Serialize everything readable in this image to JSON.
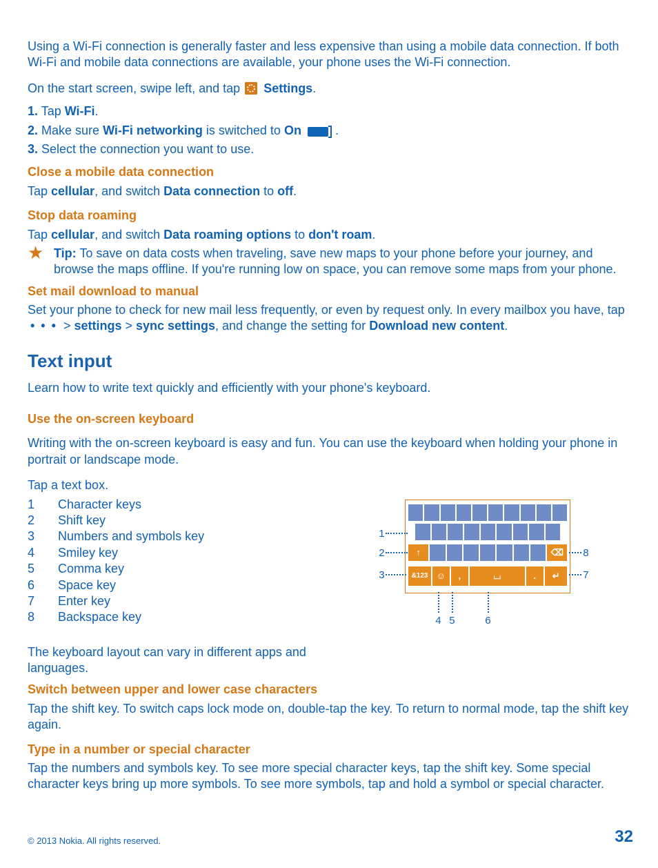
{
  "intro": {
    "p1": "Using a Wi-Fi connection is generally faster and less expensive than using a mobile data connection. If both Wi-Fi and mobile data connections are available, your phone uses the Wi-Fi connection.",
    "p2_before": "On the start screen, swipe left, and tap ",
    "p2_settings": "Settings",
    "p2_after": "."
  },
  "steps": {
    "s1": {
      "n": "1.",
      "before": " Tap ",
      "bold": "Wi-Fi",
      "after": "."
    },
    "s2": {
      "n": "2.",
      "before": " Make sure ",
      "bold1": "Wi-Fi networking",
      "mid": " is switched to ",
      "bold2": "On ",
      "after": "."
    },
    "s3": {
      "n": "3.",
      "text": " Select the connection you want to use."
    }
  },
  "close_data": {
    "heading": "Close a mobile data connection",
    "before": "Tap ",
    "b1": "cellular",
    "mid1": ", and switch ",
    "b2": "Data connection",
    "mid2": " to ",
    "b3": "off",
    "after": "."
  },
  "stop_roaming": {
    "heading": "Stop data roaming",
    "before": "Tap ",
    "b1": "cellular",
    "mid1": ", and switch ",
    "b2": "Data roaming options",
    "mid2": " to ",
    "b3": "don't roam",
    "after": "."
  },
  "tip": {
    "label": "Tip:",
    "text": " To save on data costs when traveling, save new maps to your phone before your journey, and browse the maps offline. If you're running low on space, you can remove some maps from your phone."
  },
  "mail_manual": {
    "heading": "Set mail download to manual",
    "line1": "Set your phone to check for new mail less frequently, or even by request only. In every mailbox you have, tap ",
    "ellipsis": "• • •",
    "gt1": "  > ",
    "b1": "settings",
    "gt2": " > ",
    "b2": "sync settings",
    "mid": ", and change the setting for ",
    "b3": "Download new content",
    "after": "."
  },
  "text_input": {
    "title": "Text input",
    "intro": "Learn how to write text quickly and efficiently with your phone's keyboard.",
    "use_heading": "Use the on-screen keyboard",
    "use_p": "Writing with the on-screen keyboard is easy and fun. You can use the keyboard when holding your phone in portrait or landscape mode.",
    "tap_box": "Tap a text box.",
    "legend": [
      {
        "n": "1",
        "label": "Character keys"
      },
      {
        "n": "2",
        "label": "Shift key"
      },
      {
        "n": "3",
        "label": "Numbers and symbols key"
      },
      {
        "n": "4",
        "label": "Smiley key"
      },
      {
        "n": "5",
        "label": "Comma key"
      },
      {
        "n": "6",
        "label": "Space key"
      },
      {
        "n": "7",
        "label": "Enter key"
      },
      {
        "n": "8",
        "label": "Backspace key"
      }
    ],
    "note": "The keyboard layout can vary in different apps and languages."
  },
  "switch_case": {
    "heading": "Switch between upper and lower case characters",
    "text": "Tap the shift key. To switch caps lock mode on, double-tap the key. To return to normal mode, tap the shift key again."
  },
  "type_special": {
    "heading": "Type in a number or special character",
    "text": "Tap the numbers and symbols key. To see more special character keys, tap the shift key. Some special character keys bring up more symbols. To see more symbols, tap and hold a symbol or special character."
  },
  "diagram_labels": {
    "n1": "1",
    "n2": "2",
    "n3": "3",
    "n4": "4",
    "n5": "5",
    "n6": "6",
    "n7": "7",
    "n8": "8"
  },
  "diagram_keys": {
    "sym": "&123",
    "smile": "☺",
    "comma": ",",
    "space": "⌴",
    "period": ".",
    "enter": "↵",
    "shift": "↑",
    "backspace": "⌫"
  },
  "footer": {
    "copyright": "© 2013 Nokia. All rights reserved.",
    "page": "32"
  }
}
